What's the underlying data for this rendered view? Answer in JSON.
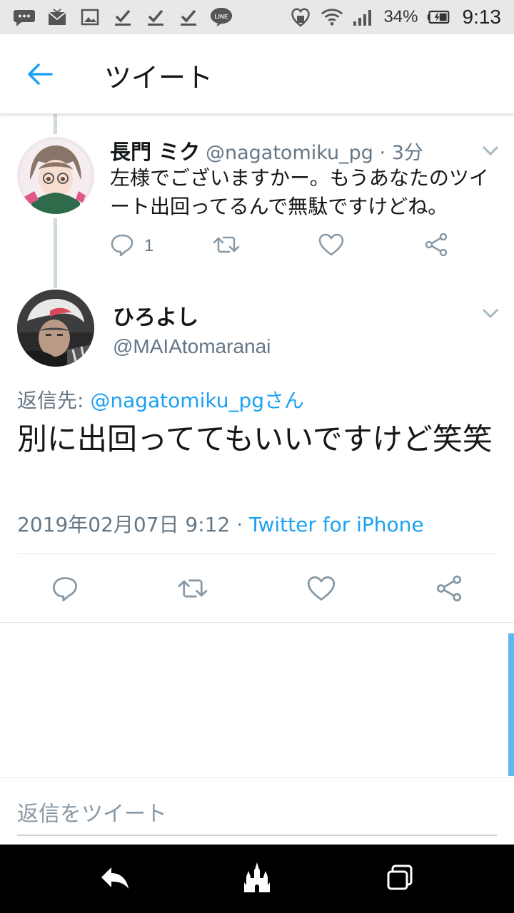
{
  "status_bar": {
    "battery_percent": "34%",
    "time": "9:13",
    "icons": [
      "chat-icon",
      "mail-icon",
      "image-icon",
      "check-icon",
      "check-icon",
      "check-icon",
      "line-icon",
      "heart-shield-icon",
      "wifi-icon",
      "signal-icon",
      "battery-icon"
    ]
  },
  "app_bar": {
    "title": "ツイート",
    "back_icon": "arrow-left-icon"
  },
  "parent_tweet": {
    "display_name": "長門 ミク",
    "handle_time": "@nagatomiku_pg · 3分",
    "text": "左様でございますかー。もうあなたのツイート出回ってるんで無駄ですけどね。",
    "reply_count": "1"
  },
  "main_tweet": {
    "display_name": "ひろよし",
    "handle": "@MAIAtomaranai",
    "reply_prefix": "返信先: ",
    "reply_mention": "@nagatomiku_pgさん",
    "text": "別に出回っててもいいですけど笑笑",
    "timestamp": "2019年02月07日 9:12 · ",
    "source": "Twitter for iPhone"
  },
  "composer": {
    "placeholder": "返信をツイート"
  },
  "colors": {
    "accent": "#1da1f2",
    "secondary_text": "#657786",
    "divider": "#dfe3e6"
  }
}
